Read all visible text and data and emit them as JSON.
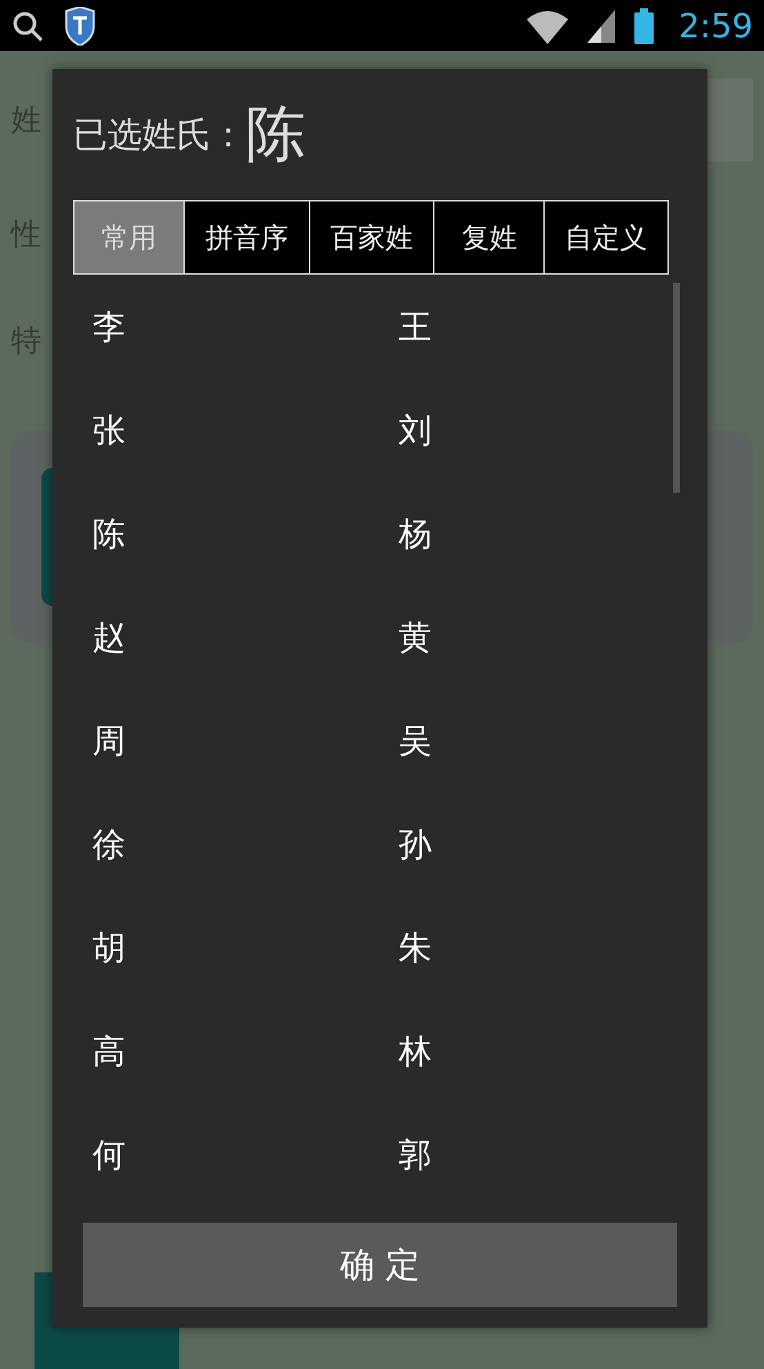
{
  "status_bar": {
    "time": "2:59"
  },
  "background_form": {
    "labels": [
      "姓",
      "性",
      "特"
    ]
  },
  "dialog": {
    "title_label": "已选姓氏：",
    "selected_surname": "陈",
    "tabs": [
      {
        "label": "常用",
        "selected": true
      },
      {
        "label": "拼音序",
        "selected": false
      },
      {
        "label": "百家姓",
        "selected": false
      },
      {
        "label": "复姓",
        "selected": false
      },
      {
        "label": "自定义",
        "selected": false
      }
    ],
    "surnames": [
      "李",
      "王",
      "张",
      "刘",
      "陈",
      "杨",
      "赵",
      "黄",
      "周",
      "吴",
      "徐",
      "孙",
      "胡",
      "朱",
      "高",
      "林",
      "何",
      "郭"
    ],
    "confirm_button": "确 定"
  }
}
